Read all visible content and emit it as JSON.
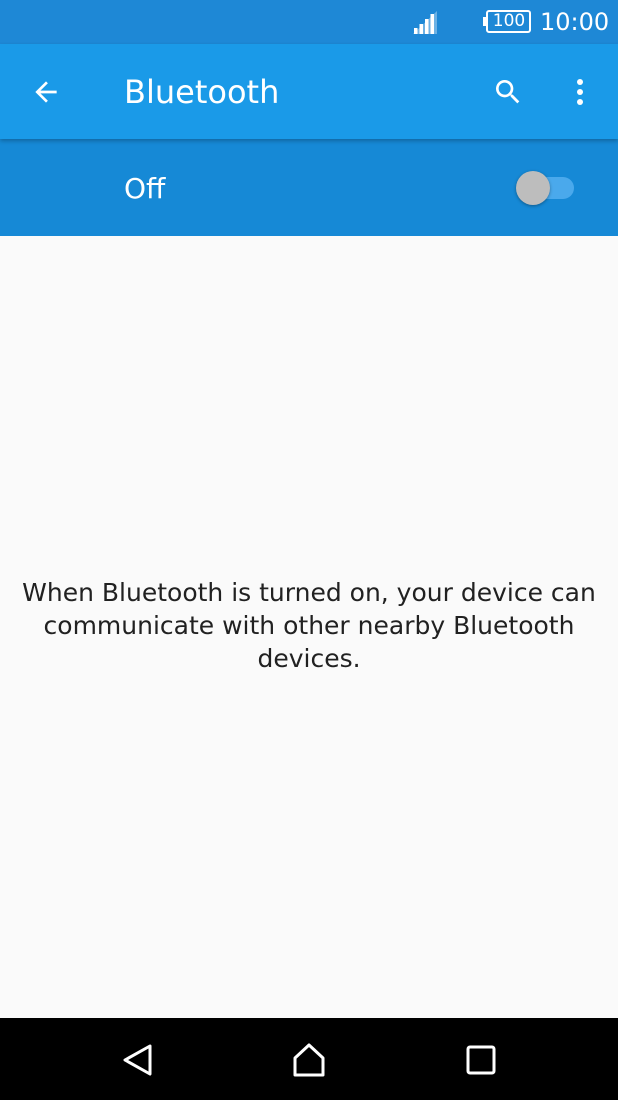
{
  "status_bar": {
    "battery_level": "100",
    "time": "10:00",
    "icons": [
      "signal-icon",
      "battery-icon"
    ]
  },
  "app_bar": {
    "title": "Bluetooth",
    "icons": [
      "back-arrow-icon",
      "search-icon",
      "more-vert-icon"
    ]
  },
  "master_switch": {
    "label": "Off",
    "state": false
  },
  "content": {
    "message": "When Bluetooth is turned on, your device can communicate with other nearby Bluetooth devices."
  },
  "nav_bar": {
    "icons": [
      "nav-back-icon",
      "nav-home-icon",
      "nav-recents-icon"
    ]
  },
  "colors": {
    "status_bar": "#1e88d6",
    "app_bar": "#1a9ae8",
    "switch_bar": "#1689d6",
    "background": "#fafafa",
    "nav_bar": "#000000"
  }
}
